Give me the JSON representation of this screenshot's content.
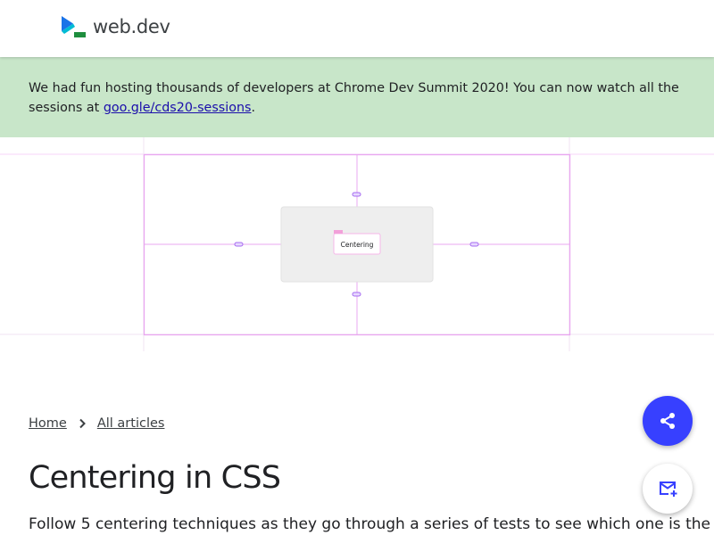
{
  "header": {
    "logo_text": "web.dev"
  },
  "banner": {
    "text_before": "We had fun hosting thousands of developers at Chrome Dev Summit 2020! You can now watch all the sessions at ",
    "link_text": "goo.gle/cds20-sessions",
    "text_after": "."
  },
  "hero": {
    "demo_label": "Centering"
  },
  "breadcrumb": {
    "home": "Home",
    "all_articles": "All articles"
  },
  "article": {
    "title": "Centering in CSS",
    "lede": "Follow 5 centering techniques as they go through a series of tests to see which one is the"
  },
  "fab": {
    "share_icon": "share-icon",
    "subscribe_icon": "mail-plus-icon"
  },
  "colors": {
    "banner_bg": "#c8e6c9",
    "brand_blue": "#3740ff",
    "guide_pink": "#e9a7f0",
    "handle_purple": "#a56bf0"
  }
}
